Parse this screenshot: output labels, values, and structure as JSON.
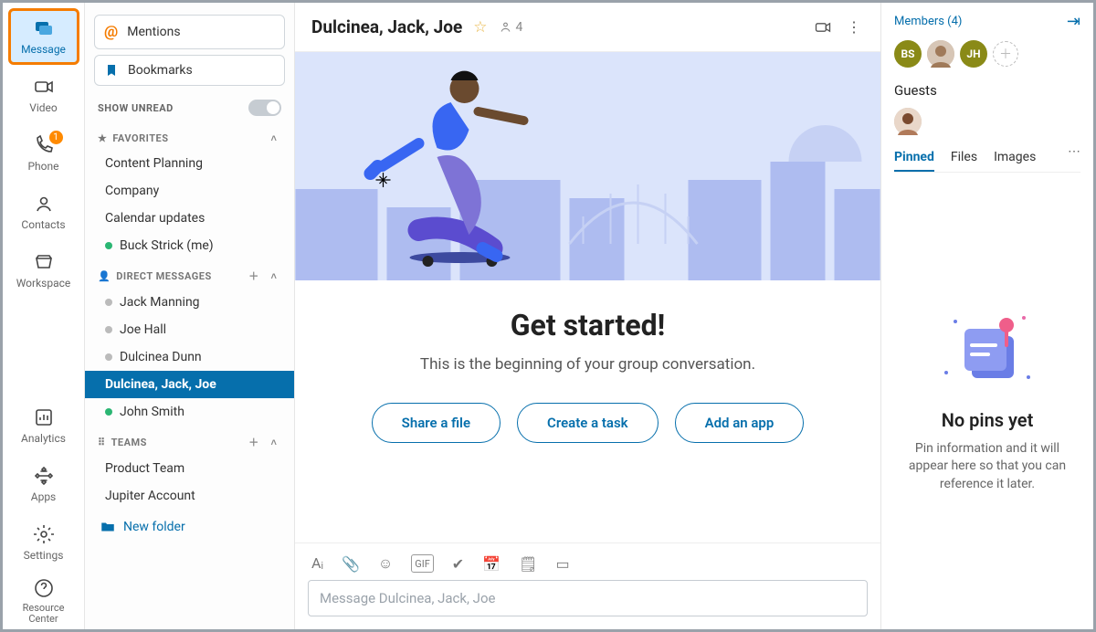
{
  "rail": {
    "items": [
      {
        "label": "Message",
        "icon": "message-icon"
      },
      {
        "label": "Video",
        "icon": "video-icon"
      },
      {
        "label": "Phone",
        "icon": "phone-icon",
        "badge": "1"
      },
      {
        "label": "Contacts",
        "icon": "contacts-icon"
      },
      {
        "label": "Workspace",
        "icon": "workspace-icon"
      },
      {
        "label": "Analytics",
        "icon": "analytics-icon"
      },
      {
        "label": "Apps",
        "icon": "apps-icon"
      },
      {
        "label": "Settings",
        "icon": "settings-icon"
      },
      {
        "label": "Resource Center",
        "icon": "help-icon"
      }
    ]
  },
  "sidebar": {
    "mentions": "Mentions",
    "bookmarks": "Bookmarks",
    "show_unread": "SHOW UNREAD",
    "sections": {
      "favorites": {
        "title": "FAVORITES",
        "items": [
          "Content Planning",
          "Company",
          "Calendar updates",
          "Buck Strick (me)"
        ]
      },
      "direct": {
        "title": "DIRECT MESSAGES",
        "items": [
          "Jack Manning",
          "Joe Hall",
          "Dulcinea Dunn",
          "Dulcinea, Jack, Joe",
          "John Smith"
        ]
      },
      "teams": {
        "title": "TEAMS",
        "items": [
          "Product Team",
          "Jupiter Account"
        ]
      }
    },
    "new_folder": "New folder"
  },
  "chat": {
    "title": "Dulcinea, Jack, Joe",
    "member_count": "4",
    "welcome_title": "Get started!",
    "welcome_sub": "This is the beginning of your group conversation.",
    "actions": [
      "Share a file",
      "Create a task",
      "Add an app"
    ],
    "composer_placeholder": "Message Dulcinea, Jack, Joe"
  },
  "rpanel": {
    "members_link": "Members (4)",
    "avatars": [
      "BS",
      "",
      "JH"
    ],
    "guests": "Guests",
    "tabs": [
      "Pinned",
      "Files",
      "Images"
    ],
    "empty_title": "No pins yet",
    "empty_body": "Pin information and it will appear here so that you can reference it later."
  }
}
